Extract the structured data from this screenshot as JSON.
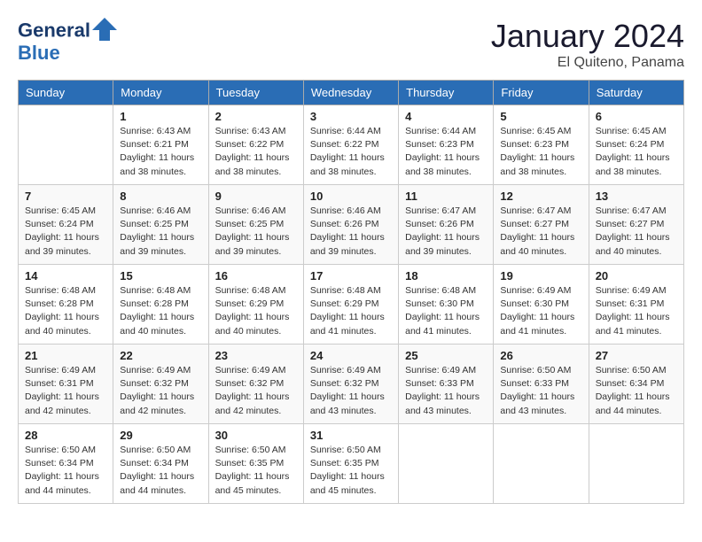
{
  "logo": {
    "line1": "General",
    "line2": "Blue"
  },
  "title": "January 2024",
  "location": "El Quiteno, Panama",
  "days_of_week": [
    "Sunday",
    "Monday",
    "Tuesday",
    "Wednesday",
    "Thursday",
    "Friday",
    "Saturday"
  ],
  "weeks": [
    [
      {
        "num": "",
        "sunrise": "",
        "sunset": "",
        "daylight": ""
      },
      {
        "num": "1",
        "sunrise": "Sunrise: 6:43 AM",
        "sunset": "Sunset: 6:21 PM",
        "daylight": "Daylight: 11 hours and 38 minutes."
      },
      {
        "num": "2",
        "sunrise": "Sunrise: 6:43 AM",
        "sunset": "Sunset: 6:22 PM",
        "daylight": "Daylight: 11 hours and 38 minutes."
      },
      {
        "num": "3",
        "sunrise": "Sunrise: 6:44 AM",
        "sunset": "Sunset: 6:22 PM",
        "daylight": "Daylight: 11 hours and 38 minutes."
      },
      {
        "num": "4",
        "sunrise": "Sunrise: 6:44 AM",
        "sunset": "Sunset: 6:23 PM",
        "daylight": "Daylight: 11 hours and 38 minutes."
      },
      {
        "num": "5",
        "sunrise": "Sunrise: 6:45 AM",
        "sunset": "Sunset: 6:23 PM",
        "daylight": "Daylight: 11 hours and 38 minutes."
      },
      {
        "num": "6",
        "sunrise": "Sunrise: 6:45 AM",
        "sunset": "Sunset: 6:24 PM",
        "daylight": "Daylight: 11 hours and 38 minutes."
      }
    ],
    [
      {
        "num": "7",
        "sunrise": "Sunrise: 6:45 AM",
        "sunset": "Sunset: 6:24 PM",
        "daylight": "Daylight: 11 hours and 39 minutes."
      },
      {
        "num": "8",
        "sunrise": "Sunrise: 6:46 AM",
        "sunset": "Sunset: 6:25 PM",
        "daylight": "Daylight: 11 hours and 39 minutes."
      },
      {
        "num": "9",
        "sunrise": "Sunrise: 6:46 AM",
        "sunset": "Sunset: 6:25 PM",
        "daylight": "Daylight: 11 hours and 39 minutes."
      },
      {
        "num": "10",
        "sunrise": "Sunrise: 6:46 AM",
        "sunset": "Sunset: 6:26 PM",
        "daylight": "Daylight: 11 hours and 39 minutes."
      },
      {
        "num": "11",
        "sunrise": "Sunrise: 6:47 AM",
        "sunset": "Sunset: 6:26 PM",
        "daylight": "Daylight: 11 hours and 39 minutes."
      },
      {
        "num": "12",
        "sunrise": "Sunrise: 6:47 AM",
        "sunset": "Sunset: 6:27 PM",
        "daylight": "Daylight: 11 hours and 40 minutes."
      },
      {
        "num": "13",
        "sunrise": "Sunrise: 6:47 AM",
        "sunset": "Sunset: 6:27 PM",
        "daylight": "Daylight: 11 hours and 40 minutes."
      }
    ],
    [
      {
        "num": "14",
        "sunrise": "Sunrise: 6:48 AM",
        "sunset": "Sunset: 6:28 PM",
        "daylight": "Daylight: 11 hours and 40 minutes."
      },
      {
        "num": "15",
        "sunrise": "Sunrise: 6:48 AM",
        "sunset": "Sunset: 6:28 PM",
        "daylight": "Daylight: 11 hours and 40 minutes."
      },
      {
        "num": "16",
        "sunrise": "Sunrise: 6:48 AM",
        "sunset": "Sunset: 6:29 PM",
        "daylight": "Daylight: 11 hours and 40 minutes."
      },
      {
        "num": "17",
        "sunrise": "Sunrise: 6:48 AM",
        "sunset": "Sunset: 6:29 PM",
        "daylight": "Daylight: 11 hours and 41 minutes."
      },
      {
        "num": "18",
        "sunrise": "Sunrise: 6:48 AM",
        "sunset": "Sunset: 6:30 PM",
        "daylight": "Daylight: 11 hours and 41 minutes."
      },
      {
        "num": "19",
        "sunrise": "Sunrise: 6:49 AM",
        "sunset": "Sunset: 6:30 PM",
        "daylight": "Daylight: 11 hours and 41 minutes."
      },
      {
        "num": "20",
        "sunrise": "Sunrise: 6:49 AM",
        "sunset": "Sunset: 6:31 PM",
        "daylight": "Daylight: 11 hours and 41 minutes."
      }
    ],
    [
      {
        "num": "21",
        "sunrise": "Sunrise: 6:49 AM",
        "sunset": "Sunset: 6:31 PM",
        "daylight": "Daylight: 11 hours and 42 minutes."
      },
      {
        "num": "22",
        "sunrise": "Sunrise: 6:49 AM",
        "sunset": "Sunset: 6:32 PM",
        "daylight": "Daylight: 11 hours and 42 minutes."
      },
      {
        "num": "23",
        "sunrise": "Sunrise: 6:49 AM",
        "sunset": "Sunset: 6:32 PM",
        "daylight": "Daylight: 11 hours and 42 minutes."
      },
      {
        "num": "24",
        "sunrise": "Sunrise: 6:49 AM",
        "sunset": "Sunset: 6:32 PM",
        "daylight": "Daylight: 11 hours and 43 minutes."
      },
      {
        "num": "25",
        "sunrise": "Sunrise: 6:49 AM",
        "sunset": "Sunset: 6:33 PM",
        "daylight": "Daylight: 11 hours and 43 minutes."
      },
      {
        "num": "26",
        "sunrise": "Sunrise: 6:50 AM",
        "sunset": "Sunset: 6:33 PM",
        "daylight": "Daylight: 11 hours and 43 minutes."
      },
      {
        "num": "27",
        "sunrise": "Sunrise: 6:50 AM",
        "sunset": "Sunset: 6:34 PM",
        "daylight": "Daylight: 11 hours and 44 minutes."
      }
    ],
    [
      {
        "num": "28",
        "sunrise": "Sunrise: 6:50 AM",
        "sunset": "Sunset: 6:34 PM",
        "daylight": "Daylight: 11 hours and 44 minutes."
      },
      {
        "num": "29",
        "sunrise": "Sunrise: 6:50 AM",
        "sunset": "Sunset: 6:34 PM",
        "daylight": "Daylight: 11 hours and 44 minutes."
      },
      {
        "num": "30",
        "sunrise": "Sunrise: 6:50 AM",
        "sunset": "Sunset: 6:35 PM",
        "daylight": "Daylight: 11 hours and 45 minutes."
      },
      {
        "num": "31",
        "sunrise": "Sunrise: 6:50 AM",
        "sunset": "Sunset: 6:35 PM",
        "daylight": "Daylight: 11 hours and 45 minutes."
      },
      {
        "num": "",
        "sunrise": "",
        "sunset": "",
        "daylight": ""
      },
      {
        "num": "",
        "sunrise": "",
        "sunset": "",
        "daylight": ""
      },
      {
        "num": "",
        "sunrise": "",
        "sunset": "",
        "daylight": ""
      }
    ]
  ]
}
